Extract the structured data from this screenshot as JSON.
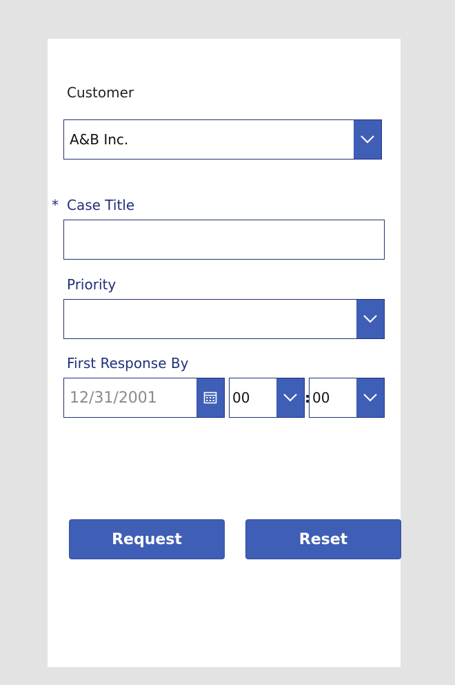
{
  "form": {
    "customer": {
      "label": "Customer",
      "value": "A&B Inc."
    },
    "case_title": {
      "required_marker": "*",
      "label": "Case Title",
      "value": ""
    },
    "priority": {
      "label": "Priority",
      "value": ""
    },
    "first_response_by": {
      "label": "First Response By",
      "date_placeholder": "12/31/2001",
      "hour": "00",
      "time_separator": ":",
      "minute": "00"
    }
  },
  "actions": {
    "request_label": "Request",
    "reset_label": "Reset"
  },
  "colors": {
    "accent": "#3f5eb6",
    "label_blue": "#1f2f7a",
    "background": "#e3e3e3",
    "card": "#ffffff"
  },
  "icons": {
    "dropdown": "chevron-down-icon",
    "date": "calendar-icon"
  }
}
